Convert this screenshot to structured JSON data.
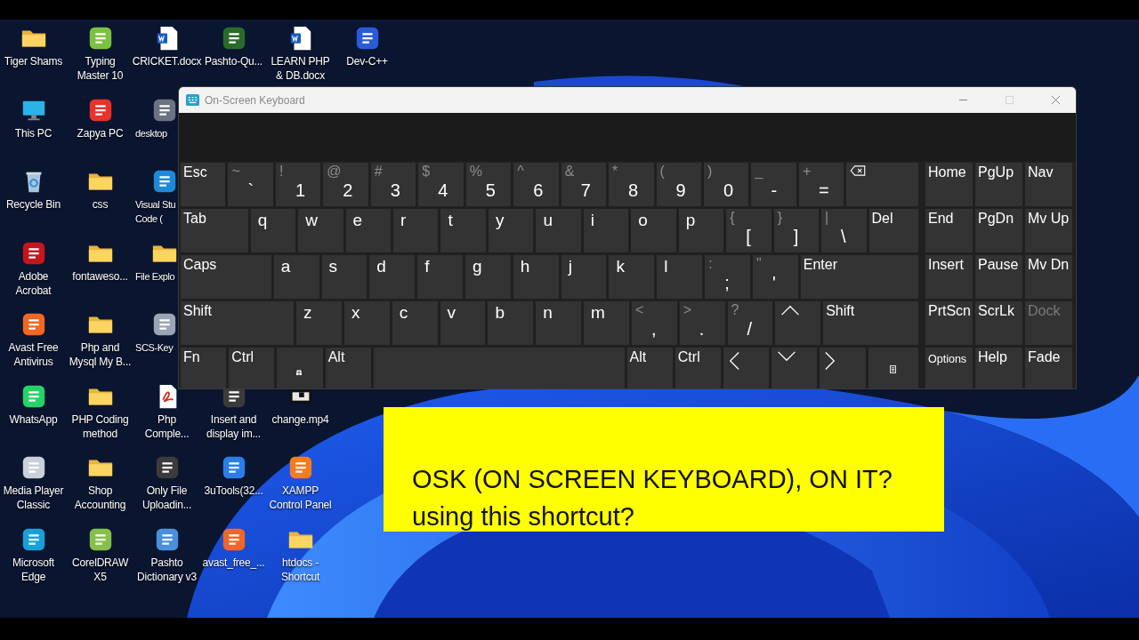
{
  "desktop": {
    "left_icons": [
      {
        "kind": "folder",
        "label": "Tiger  Shams"
      },
      {
        "kind": "monitor",
        "label": "This PC"
      },
      {
        "kind": "recycle",
        "label": "Recycle Bin"
      },
      {
        "kind": "app",
        "color": "#c4161c",
        "label": "Adobe\nAcrobat"
      },
      {
        "kind": "app",
        "color": "#f26722",
        "label": "Avast Free\nAntivirus"
      },
      {
        "kind": "app",
        "color": "#25d366",
        "label": "WhatsApp"
      },
      {
        "kind": "app",
        "color": "#c9d0da",
        "label": "Media Player\nClassic"
      },
      {
        "kind": "app",
        "color": "#1aa0d8",
        "label": "Microsoft\nEdge"
      },
      {
        "kind": "app",
        "color": "#7cc242",
        "label": "Typing\nMaster 10"
      },
      {
        "kind": "app",
        "color": "#e8322b",
        "label": "Zapya PC"
      },
      {
        "kind": "folder",
        "label": "css"
      },
      {
        "kind": "folder",
        "label": "fontaweso..."
      },
      {
        "kind": "folder",
        "label": "Php and\nMysql My B..."
      },
      {
        "kind": "folder",
        "label": "PHP Coding\nmethod"
      },
      {
        "kind": "folder",
        "label": "Shop\nAccounting"
      },
      {
        "kind": "app",
        "color": "#86c04b",
        "label": "CorelDRAW\nX5"
      },
      {
        "kind": "word",
        "label": "CRICKET.docx"
      },
      {
        "kind": "app",
        "color": "#6b7280",
        "label": "desktop"
      },
      {
        "kind": "app",
        "color": "#1e8ad6",
        "label": "Visual Stu\nCode ("
      },
      {
        "kind": "folder",
        "label": "File Explo"
      },
      {
        "kind": "app",
        "color": "#9aa5b5",
        "label": "SCS-Key"
      },
      {
        "kind": "pdf",
        "label": "Php\nComple..."
      },
      {
        "kind": "app",
        "color": "#3b3b3b",
        "label": "Only File\nUploadin..."
      },
      {
        "kind": "app",
        "color": "#4a90d9",
        "label": "Pashto\nDictionary v3"
      }
    ],
    "top_row_icons": [
      {
        "kind": "app",
        "color": "#2a6b2a",
        "label": "Pashto-Qu..."
      },
      {
        "kind": "word",
        "label": "LEARN PHP\n& DB.docx"
      },
      {
        "kind": "app",
        "color": "#2a5bd7",
        "label": "Dev-C++"
      }
    ],
    "lower_icons": [
      {
        "kind": "app",
        "color": "#3b3b3b",
        "label": "Insert and\ndisplay im..."
      },
      {
        "kind": "app",
        "color": "#2b7de9",
        "label": "3uTools(32..."
      },
      {
        "kind": "app",
        "color": "#f26722",
        "label": "avast_free_..."
      },
      {
        "kind": "video",
        "label": "change.mp4"
      },
      {
        "kind": "app",
        "color": "#f37b20",
        "label": "XAMPP\nControl Panel"
      },
      {
        "kind": "folder",
        "label": "htdocs -\nShortcut"
      }
    ]
  },
  "window": {
    "title": "On-Screen Keyboard",
    "maximize_disabled": true
  },
  "keyboard": {
    "rows": [
      [
        {
          "kind": "label",
          "label": "Esc"
        },
        {
          "kind": "shifted",
          "shift": "~",
          "base": "`"
        },
        {
          "kind": "shifted",
          "shift": "!",
          "base": "1"
        },
        {
          "kind": "shifted",
          "shift": "@",
          "base": "2"
        },
        {
          "kind": "shifted",
          "shift": "#",
          "base": "3"
        },
        {
          "kind": "shifted",
          "shift": "$",
          "base": "4"
        },
        {
          "kind": "shifted",
          "shift": "%",
          "base": "5"
        },
        {
          "kind": "shifted",
          "shift": "^",
          "base": "6"
        },
        {
          "kind": "shifted",
          "shift": "&",
          "base": "7"
        },
        {
          "kind": "shifted",
          "shift": "*",
          "base": "8"
        },
        {
          "kind": "shifted",
          "shift": "(",
          "base": "9"
        },
        {
          "kind": "shifted",
          "shift": ")",
          "base": "0"
        },
        {
          "kind": "shifted",
          "shift": "_",
          "base": "-"
        },
        {
          "kind": "shifted",
          "shift": "+",
          "base": "="
        },
        {
          "kind": "backspace"
        }
      ],
      [
        {
          "kind": "label",
          "label": "Tab"
        },
        {
          "kind": "letter",
          "label": "q"
        },
        {
          "kind": "letter",
          "label": "w"
        },
        {
          "kind": "letter",
          "label": "e"
        },
        {
          "kind": "letter",
          "label": "r"
        },
        {
          "kind": "letter",
          "label": "t"
        },
        {
          "kind": "letter",
          "label": "y"
        },
        {
          "kind": "letter",
          "label": "u"
        },
        {
          "kind": "letter",
          "label": "i"
        },
        {
          "kind": "letter",
          "label": "o"
        },
        {
          "kind": "letter",
          "label": "p"
        },
        {
          "kind": "shifted",
          "shift": "{",
          "base": "["
        },
        {
          "kind": "shifted",
          "shift": "}",
          "base": "]"
        },
        {
          "kind": "shifted",
          "shift": "|",
          "base": "\\"
        },
        {
          "kind": "label",
          "label": "Del"
        }
      ],
      [
        {
          "kind": "label",
          "label": "Caps"
        },
        {
          "kind": "letter",
          "label": "a"
        },
        {
          "kind": "letter",
          "label": "s"
        },
        {
          "kind": "letter",
          "label": "d"
        },
        {
          "kind": "letter",
          "label": "f"
        },
        {
          "kind": "letter",
          "label": "g"
        },
        {
          "kind": "letter",
          "label": "h"
        },
        {
          "kind": "letter",
          "label": "j"
        },
        {
          "kind": "letter",
          "label": "k"
        },
        {
          "kind": "letter",
          "label": "l"
        },
        {
          "kind": "shifted",
          "shift": ":",
          "base": ";"
        },
        {
          "kind": "shifted",
          "shift": "\"",
          "base": "'"
        },
        {
          "kind": "label",
          "label": "Enter"
        }
      ],
      [
        {
          "kind": "label",
          "label": "Shift"
        },
        {
          "kind": "letter",
          "label": "z"
        },
        {
          "kind": "letter",
          "label": "x"
        },
        {
          "kind": "letter",
          "label": "c"
        },
        {
          "kind": "letter",
          "label": "v"
        },
        {
          "kind": "letter",
          "label": "b"
        },
        {
          "kind": "letter",
          "label": "n"
        },
        {
          "kind": "letter",
          "label": "m"
        },
        {
          "kind": "shifted",
          "shift": "<",
          "base": ","
        },
        {
          "kind": "shifted",
          "shift": ">",
          "base": "."
        },
        {
          "kind": "shifted",
          "shift": "?",
          "base": "/"
        },
        {
          "kind": "up"
        },
        {
          "kind": "label",
          "label": "Shift"
        }
      ],
      [
        {
          "kind": "label",
          "label": "Fn"
        },
        {
          "kind": "label",
          "label": "Ctrl"
        },
        {
          "kind": "windows"
        },
        {
          "kind": "label",
          "label": "Alt"
        },
        {
          "kind": "space"
        },
        {
          "kind": "label",
          "label": "Alt"
        },
        {
          "kind": "label",
          "label": "Ctrl"
        },
        {
          "kind": "left"
        },
        {
          "kind": "down"
        },
        {
          "kind": "right"
        },
        {
          "kind": "menu"
        }
      ]
    ],
    "nav_keys": [
      {
        "label": "Home",
        "disabled": false
      },
      {
        "label": "PgUp",
        "disabled": false
      },
      {
        "label": "Nav",
        "disabled": false
      },
      {
        "label": "End",
        "disabled": false
      },
      {
        "label": "PgDn",
        "disabled": false
      },
      {
        "label": "Mv Up",
        "disabled": false
      },
      {
        "label": "Insert",
        "disabled": false
      },
      {
        "label": "Pause",
        "disabled": false
      },
      {
        "label": "Mv Dn",
        "disabled": false
      },
      {
        "label": "PrtScn",
        "disabled": false
      },
      {
        "label": "ScrLk",
        "disabled": false
      },
      {
        "label": "Dock",
        "disabled": true
      },
      {
        "label": "Options",
        "disabled": false,
        "kind": "small"
      },
      {
        "label": "Help",
        "disabled": false
      },
      {
        "label": "Fade",
        "disabled": false
      }
    ]
  },
  "caption": {
    "lines": [
      "OSK (ON SCREEN KEYBOARD), ON IT?",
      "using this shortcut?"
    ]
  }
}
